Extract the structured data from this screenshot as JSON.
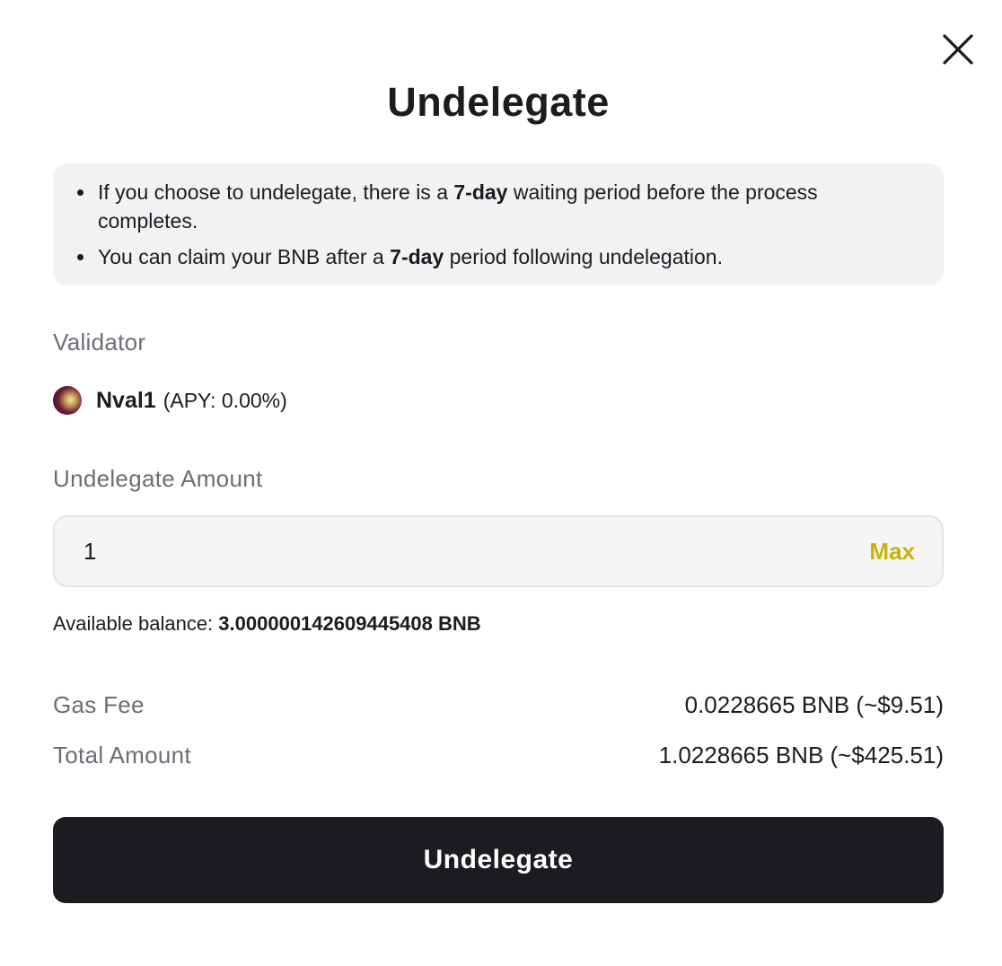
{
  "dialog": {
    "title": "Undelegate",
    "close_icon": "close-icon"
  },
  "info": {
    "items": [
      {
        "prefix": "If you choose to undelegate, there is a ",
        "bold": "7-day",
        "suffix": " waiting period before the process completes."
      },
      {
        "prefix": "You can claim your BNB after a ",
        "bold": "7-day",
        "suffix": " period following undelegation."
      }
    ]
  },
  "validator": {
    "label": "Validator",
    "name": "Nval1",
    "apy": "(APY: 0.00%)",
    "avatar_icon": "validator-avatar"
  },
  "amount": {
    "label": "Undelegate Amount",
    "value": "1",
    "max_label": "Max"
  },
  "balance": {
    "label": "Available balance: ",
    "value": "3.000000142609445408 BNB"
  },
  "fees": {
    "gas_label": "Gas Fee",
    "gas_value": "0.0228665 BNB (~$9.51)",
    "total_label": "Total Amount",
    "total_value": "1.0228665 BNB (~$425.51)"
  },
  "actions": {
    "submit_label": "Undelegate"
  },
  "colors": {
    "accent_max": "#c9b00e",
    "button_bg": "#1b1c1f",
    "info_bg": "#f1f2f4"
  }
}
